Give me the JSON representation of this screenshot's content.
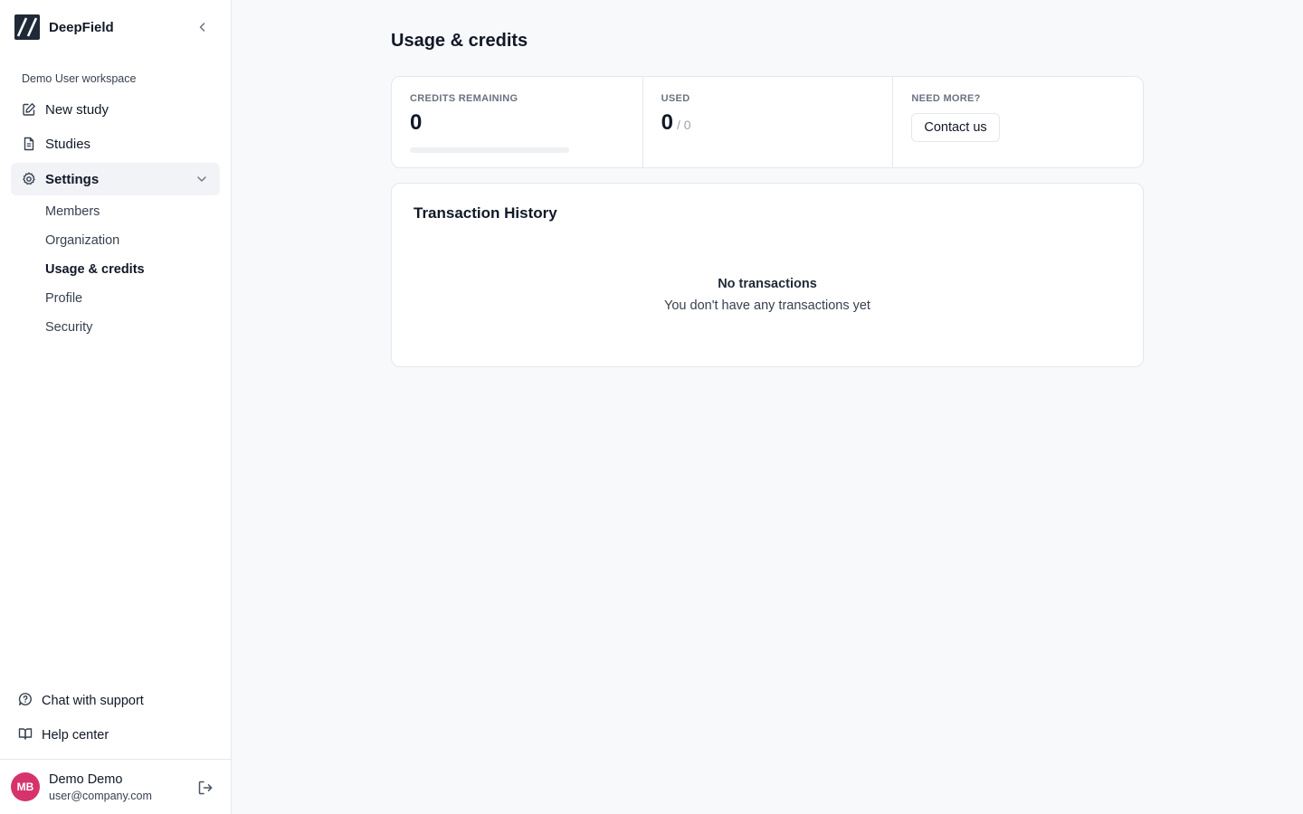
{
  "brand": {
    "name": "DeepField"
  },
  "sidebar": {
    "workspace": "Demo User workspace",
    "nav": [
      {
        "label": "New study",
        "icon": "edit-icon"
      },
      {
        "label": "Studies",
        "icon": "document-icon"
      },
      {
        "label": "Settings",
        "icon": "gear-icon"
      }
    ],
    "settings_items": [
      {
        "label": "Members"
      },
      {
        "label": "Organization"
      },
      {
        "label": "Usage & credits"
      },
      {
        "label": "Profile"
      },
      {
        "label": "Security"
      }
    ],
    "footer": [
      {
        "label": "Chat with support",
        "icon": "chat-icon"
      },
      {
        "label": "Help center",
        "icon": "book-icon"
      }
    ]
  },
  "user": {
    "initials": "MB",
    "name": "Demo Demo",
    "email": "user@company.com",
    "avatar_color": "#d6336c"
  },
  "main": {
    "title": "Usage & credits",
    "stats": {
      "remaining_label": "CREDITS REMAINING",
      "remaining_value": "0",
      "remaining_fraction": 0,
      "used_label": "USED",
      "used_value": "0",
      "used_total": "/ 0",
      "more_label": "NEED MORE?",
      "contact_label": "Contact us"
    },
    "history": {
      "title": "Transaction History",
      "empty_title": "No transactions",
      "empty_subtitle": "You don't have any transactions yet"
    }
  }
}
